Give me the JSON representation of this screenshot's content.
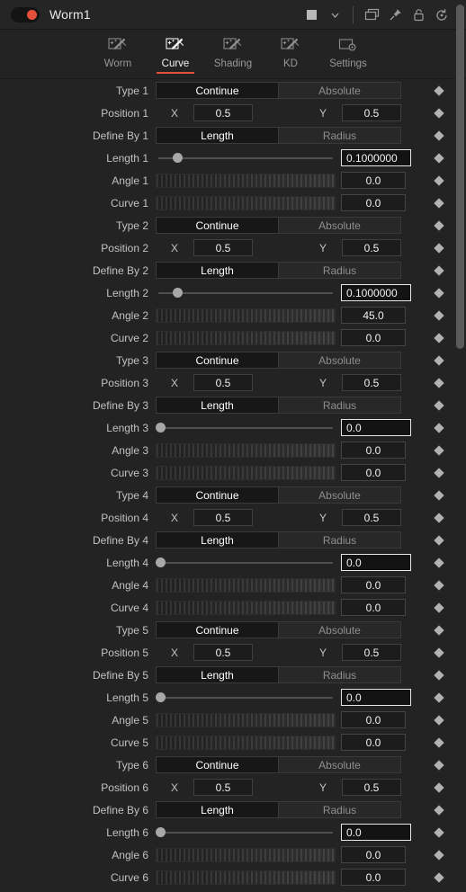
{
  "titlebar": {
    "node_name": "Worm1",
    "toggle_icon": "power-toggle-icon",
    "toggle_color": "#e5503a",
    "buttons": [
      {
        "name": "color-swatch-icon",
        "label": ""
      },
      {
        "name": "chevron-down-icon",
        "label": "∨"
      },
      {
        "name": "copy-layers-icon",
        "label": ""
      },
      {
        "name": "pin-icon",
        "label": ""
      },
      {
        "name": "lock-icon",
        "label": ""
      },
      {
        "name": "reset-history-icon",
        "label": ""
      }
    ]
  },
  "tabs": [
    {
      "label": "Worm",
      "icon": "magic-wand-icon",
      "active": false
    },
    {
      "label": "Curve",
      "icon": "magic-wand-icon",
      "active": true
    },
    {
      "label": "Shading",
      "icon": "magic-wand-icon",
      "active": false
    },
    {
      "label": "KD",
      "icon": "magic-wand-icon",
      "active": false
    },
    {
      "label": "Settings",
      "icon": "settings-gear-icon",
      "active": false
    }
  ],
  "accent_color": "#e0503a",
  "segments": [
    {
      "type": {
        "label": "Type 1",
        "options": [
          "Continue",
          "Absolute"
        ],
        "selected": "Continue"
      },
      "position": {
        "label": "Position 1",
        "x_axis": "X",
        "x_value": "0.5",
        "y_axis": "Y",
        "y_value": "0.5"
      },
      "define_by": {
        "label": "Define By 1",
        "options": [
          "Length",
          "Radius"
        ],
        "selected": "Length"
      },
      "length": {
        "label": "Length 1",
        "value": "0.1000000",
        "slider_pct": 10
      },
      "angle": {
        "label": "Angle 1",
        "value": "0.0"
      },
      "curve": {
        "label": "Curve 1",
        "value": "0.0"
      }
    },
    {
      "type": {
        "label": "Type 2",
        "options": [
          "Continue",
          "Absolute"
        ],
        "selected": "Continue"
      },
      "position": {
        "label": "Position 2",
        "x_axis": "X",
        "x_value": "0.5",
        "y_axis": "Y",
        "y_value": "0.5"
      },
      "define_by": {
        "label": "Define By 2",
        "options": [
          "Length",
          "Radius"
        ],
        "selected": "Length"
      },
      "length": {
        "label": "Length 2",
        "value": "0.1000000",
        "slider_pct": 10
      },
      "angle": {
        "label": "Angle 2",
        "value": "45.0"
      },
      "curve": {
        "label": "Curve 2",
        "value": "0.0"
      }
    },
    {
      "type": {
        "label": "Type 3",
        "options": [
          "Continue",
          "Absolute"
        ],
        "selected": "Continue"
      },
      "position": {
        "label": "Position 3",
        "x_axis": "X",
        "x_value": "0.5",
        "y_axis": "Y",
        "y_value": "0.5"
      },
      "define_by": {
        "label": "Define By 3",
        "options": [
          "Length",
          "Radius"
        ],
        "selected": "Length"
      },
      "length": {
        "label": "Length 3",
        "value": "0.0",
        "slider_pct": 0
      },
      "angle": {
        "label": "Angle 3",
        "value": "0.0"
      },
      "curve": {
        "label": "Curve 3",
        "value": "0.0"
      }
    },
    {
      "type": {
        "label": "Type 4",
        "options": [
          "Continue",
          "Absolute"
        ],
        "selected": "Continue"
      },
      "position": {
        "label": "Position 4",
        "x_axis": "X",
        "x_value": "0.5",
        "y_axis": "Y",
        "y_value": "0.5"
      },
      "define_by": {
        "label": "Define By 4",
        "options": [
          "Length",
          "Radius"
        ],
        "selected": "Length"
      },
      "length": {
        "label": "Length 4",
        "value": "0.0",
        "slider_pct": 0
      },
      "angle": {
        "label": "Angle 4",
        "value": "0.0"
      },
      "curve": {
        "label": "Curve 4",
        "value": "0.0"
      }
    },
    {
      "type": {
        "label": "Type 5",
        "options": [
          "Continue",
          "Absolute"
        ],
        "selected": "Continue"
      },
      "position": {
        "label": "Position 5",
        "x_axis": "X",
        "x_value": "0.5",
        "y_axis": "Y",
        "y_value": "0.5"
      },
      "define_by": {
        "label": "Define By 5",
        "options": [
          "Length",
          "Radius"
        ],
        "selected": "Length"
      },
      "length": {
        "label": "Length 5",
        "value": "0.0",
        "slider_pct": 0
      },
      "angle": {
        "label": "Angle 5",
        "value": "0.0"
      },
      "curve": {
        "label": "Curve 5",
        "value": "0.0"
      }
    },
    {
      "type": {
        "label": "Type 6",
        "options": [
          "Continue",
          "Absolute"
        ],
        "selected": "Continue"
      },
      "position": {
        "label": "Position 6",
        "x_axis": "X",
        "x_value": "0.5",
        "y_axis": "Y",
        "y_value": "0.5"
      },
      "define_by": {
        "label": "Define By 6",
        "options": [
          "Length",
          "Radius"
        ],
        "selected": "Length"
      },
      "length": {
        "label": "Length 6",
        "value": "0.0",
        "slider_pct": 0
      },
      "angle": {
        "label": "Angle 6",
        "value": "0.0"
      },
      "curve": {
        "label": "Curve 6",
        "value": "0.0"
      }
    }
  ]
}
